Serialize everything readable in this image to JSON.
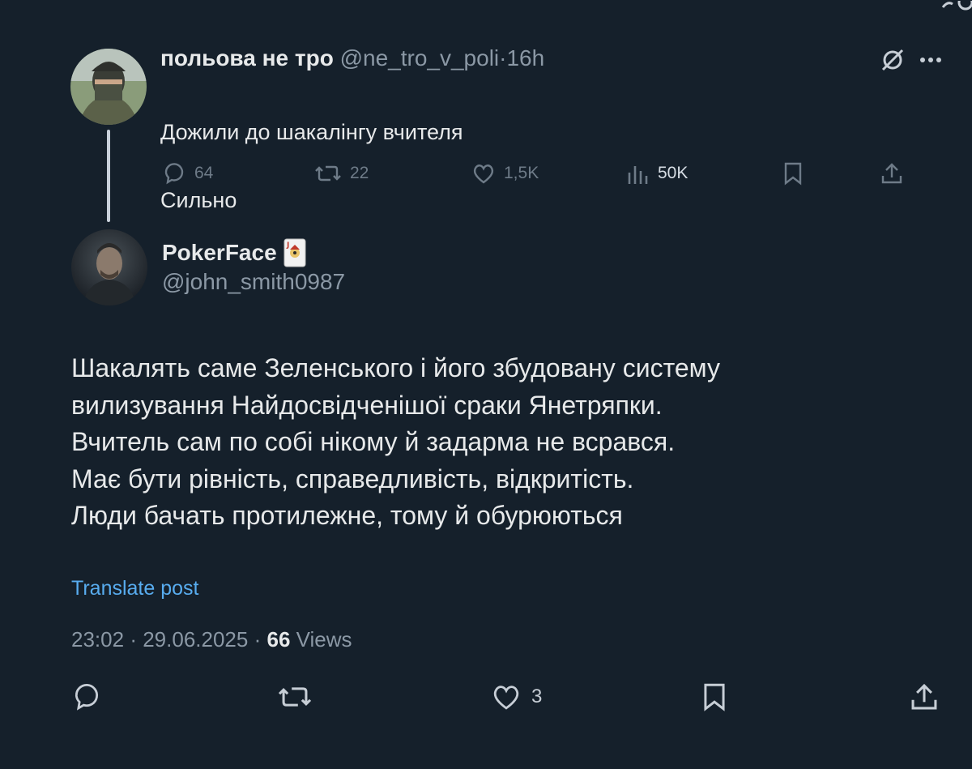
{
  "parent_post": {
    "display_name": "польова не тро",
    "handle": "@ne_tro_v_poli",
    "separator": "·",
    "time": "16h",
    "lines": [
      "Дожили до шакалінгу вчителя",
      "Сильно"
    ],
    "replies": "64",
    "reposts": "22",
    "likes": "1,5K",
    "views": "50K",
    "icons": [
      "grok-icon",
      "more-icon",
      "reply-icon",
      "repost-icon",
      "like-icon",
      "views-icon",
      "bookmark-icon",
      "share-icon"
    ]
  },
  "reply_post": {
    "display_name": "PokerFace",
    "handle": "@john_smith0987",
    "badge_icon": "joker-card-icon",
    "body_lines": [
      "Шакалять саме Зеленського і його збудовану систему",
      "вилизування Найдосвідченішої сраки Янетряпки.",
      "Вчитель сам по собі нікому й задарма не всрався.",
      "Має бути рівність, справедливість, відкритість.",
      "Люди бачать протилежне, тому й обурюються"
    ],
    "translate_label": "Translate post",
    "time": "23:02",
    "date": "29.06.2025",
    "separator": "·",
    "views_count": "66",
    "views_label": "Views",
    "likes": "3"
  },
  "colors": {
    "background": "#15202b",
    "text": "#e7e9ea",
    "muted": "#8b98a5",
    "link": "#58acef"
  }
}
